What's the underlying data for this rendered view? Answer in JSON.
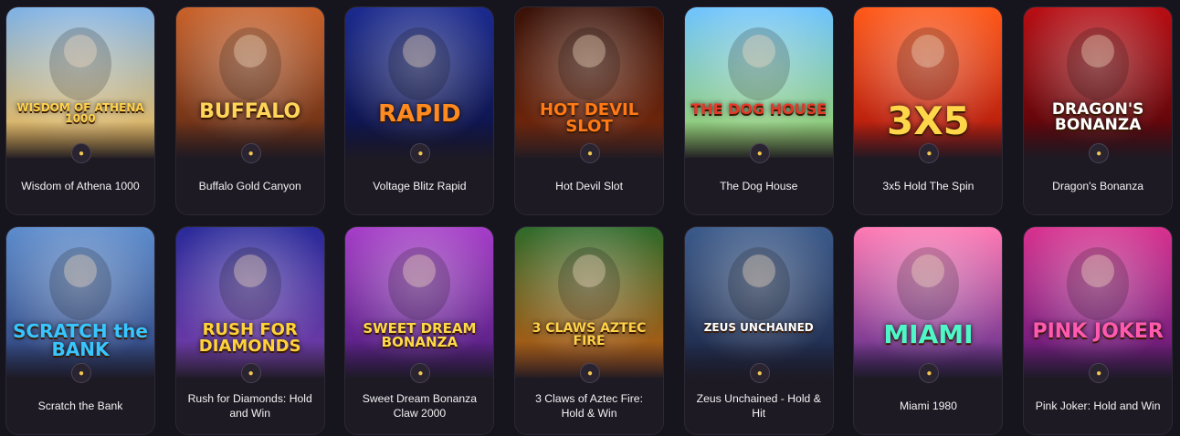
{
  "games": [
    {
      "name": "Wisdom of Athena 1000",
      "art": "WISDOM OF ATHENA 1000",
      "bg": [
        "#7fb2e6",
        "#f5b94a"
      ],
      "fg": "#ffd24d",
      "size": 12
    },
    {
      "name": "Buffalo Gold Canyon",
      "art": "BUFFALO",
      "bg": [
        "#c9622b",
        "#5a2712"
      ],
      "fg": "#ffd45a",
      "size": 22
    },
    {
      "name": "Voltage Blitz Rapid",
      "art": "RAPID",
      "bg": [
        "#1b2a8f",
        "#0b0f3d"
      ],
      "fg": "#ff8a1f",
      "size": 26
    },
    {
      "name": "Hot Devil Slot",
      "art": "HOT DEVIL SLOT",
      "bg": [
        "#3a1208",
        "#7a2a0c"
      ],
      "fg": "#ff7a16",
      "size": 18
    },
    {
      "name": "The Dog House",
      "art": "THE DOG HOUSE",
      "bg": [
        "#6fc4ff",
        "#9ad05a"
      ],
      "fg": "#e23a2a",
      "size": 16
    },
    {
      "name": "3x5 Hold The Spin",
      "art": "3X5",
      "bg": [
        "#ff5a1a",
        "#a8100a"
      ],
      "fg": "#ffd54a",
      "size": 42
    },
    {
      "name": "Dragon's Bonanza",
      "art": "DRAGON'S BONANZA",
      "bg": [
        "#b80e14",
        "#4a0408"
      ],
      "fg": "#ffffff",
      "size": 17
    },
    {
      "name": "Scratch the Bank",
      "art": "SCRATCH the BANK",
      "bg": [
        "#5d8ccc",
        "#2c3f7a"
      ],
      "fg": "#39c6ff",
      "size": 20
    },
    {
      "name": "Rush for Diamonds: Hold and Win",
      "art": "RUSH FOR DIAMONDS",
      "bg": [
        "#2a2a9a",
        "#7a3ea8"
      ],
      "fg": "#ffd23a",
      "size": 18
    },
    {
      "name": "Sweet Dream Bonanza Claw 2000",
      "art": "SWEET DREAM BONANZA",
      "bg": [
        "#a63ec8",
        "#4a1a78"
      ],
      "fg": "#ffd84a",
      "size": 15
    },
    {
      "name": "3 Claws of Aztec Fire: Hold & Win",
      "art": "3 CLAWS AZTEC FIRE",
      "bg": [
        "#2f6a2a",
        "#c25a12"
      ],
      "fg": "#ffd24a",
      "size": 14
    },
    {
      "name": "Zeus Unchained - Hold & Hit",
      "art": "ZEUS UNCHAINED",
      "bg": [
        "#3b5a8a",
        "#1a2444"
      ],
      "fg": "#ffffff",
      "size": 12
    },
    {
      "name": "Miami 1980",
      "art": "MIAMI",
      "bg": [
        "#ff7ab4",
        "#5a2a8a"
      ],
      "fg": "#4ef7c8",
      "size": 28
    },
    {
      "name": "Pink Joker: Hold and Win",
      "art": "PINK JOKER",
      "bg": [
        "#d8328f",
        "#5a1878"
      ],
      "fg": "#ff5ab0",
      "size": 22
    }
  ]
}
